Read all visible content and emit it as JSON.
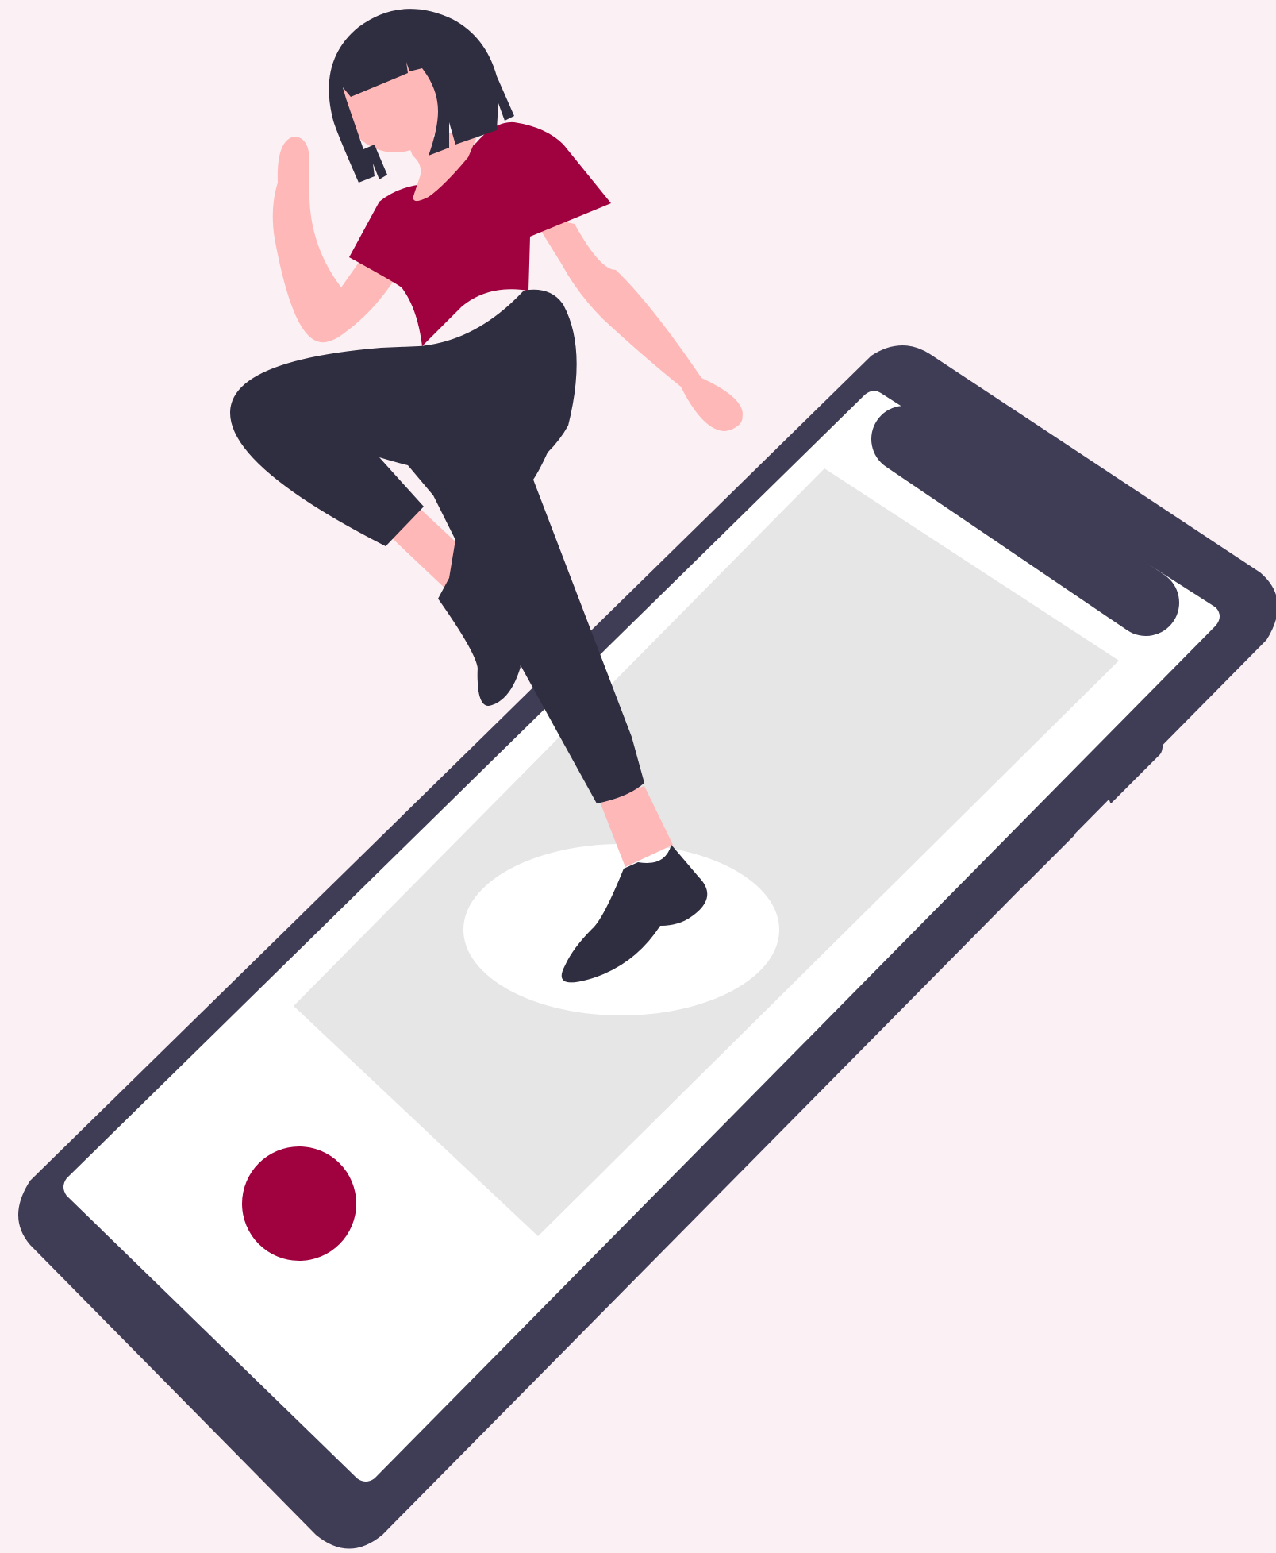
{
  "colors": {
    "background": "#fbf0f3",
    "phone_frame": "#3f3d56",
    "phone_screen": "#ffffff",
    "screen_panel": "#e6e6e6",
    "accent": "#a0023f",
    "hair_and_pants": "#2f2e41",
    "skin": "#ffb8b8",
    "platform": "#ffffff"
  },
  "icons": {
    "record_button": "filled-circle",
    "speaker_slot": "pill"
  }
}
